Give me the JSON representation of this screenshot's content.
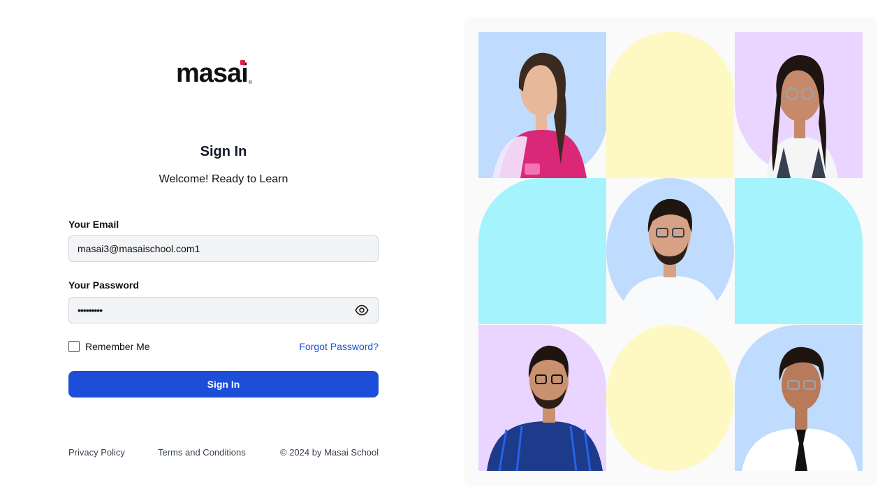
{
  "brand": {
    "logo_text": "masai",
    "logo_accent": "#e11d48",
    "registered_mark": "®"
  },
  "signin": {
    "title": "Sign In",
    "subtitle": "Welcome! Ready to Learn",
    "email_label": "Your Email",
    "email_value": "masai3@masaischool.com1",
    "password_label": "Your Password",
    "password_value": "•••••••••",
    "eye_icon": "eye-icon",
    "remember_label": "Remember Me",
    "remember_checked": false,
    "forgot_label": "Forgot Password?",
    "submit_label": "Sign In"
  },
  "footer": {
    "privacy": "Privacy Policy",
    "terms": "Terms and Conditions",
    "copyright": "© 2024 by Masai School"
  },
  "colors": {
    "primary": "#1d4ed8",
    "blue_tile": "#bfdbfe",
    "yellow_tile": "#fef9c3",
    "purple_tile": "#e9d5ff",
    "cyan_tile": "#a5f3fc"
  }
}
